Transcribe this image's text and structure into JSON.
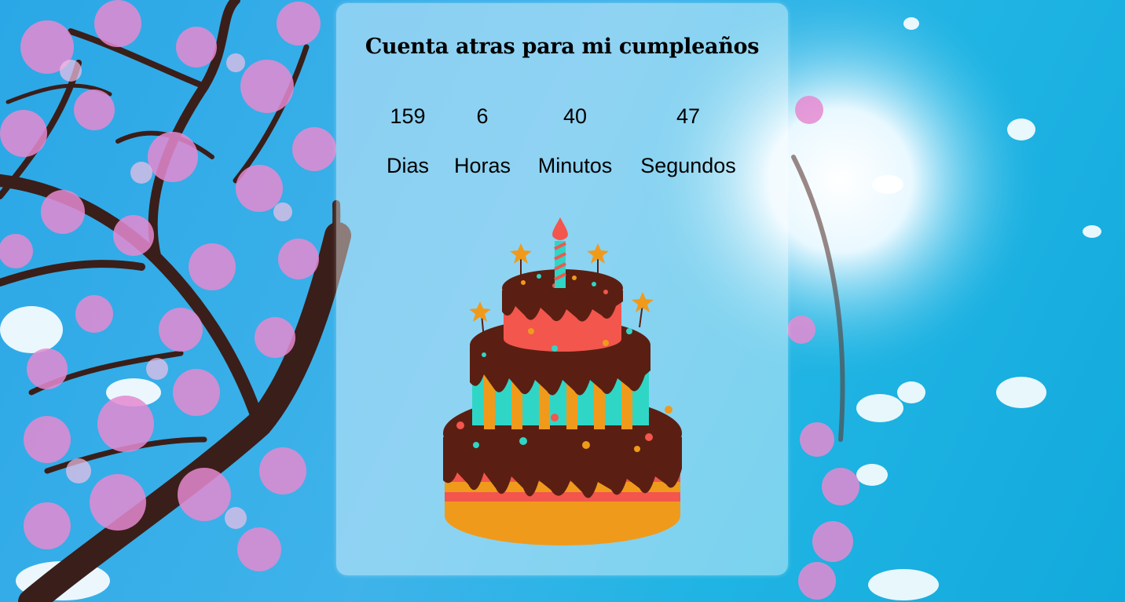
{
  "page": {
    "title": "Cuenta atras para mi cumpleaños"
  },
  "countdown": {
    "days": {
      "value": "159",
      "label": "Dias"
    },
    "hours": {
      "value": "6",
      "label": "Horas"
    },
    "minutes": {
      "value": "40",
      "label": "Minutos"
    },
    "seconds": {
      "value": "47",
      "label": "Segundos"
    }
  },
  "colors": {
    "sky": "#1fb4e3",
    "blossom": "#e79bd6",
    "branch": "#3a1e1a",
    "cake_chocolate": "#5a1f12",
    "cake_coral": "#f2564d",
    "cake_teal": "#2fd6c6",
    "cake_orange": "#f09a1c"
  },
  "images": {
    "background": "cherry-blossom-tree-sky",
    "cake": "birthday-cake-three-tier"
  }
}
